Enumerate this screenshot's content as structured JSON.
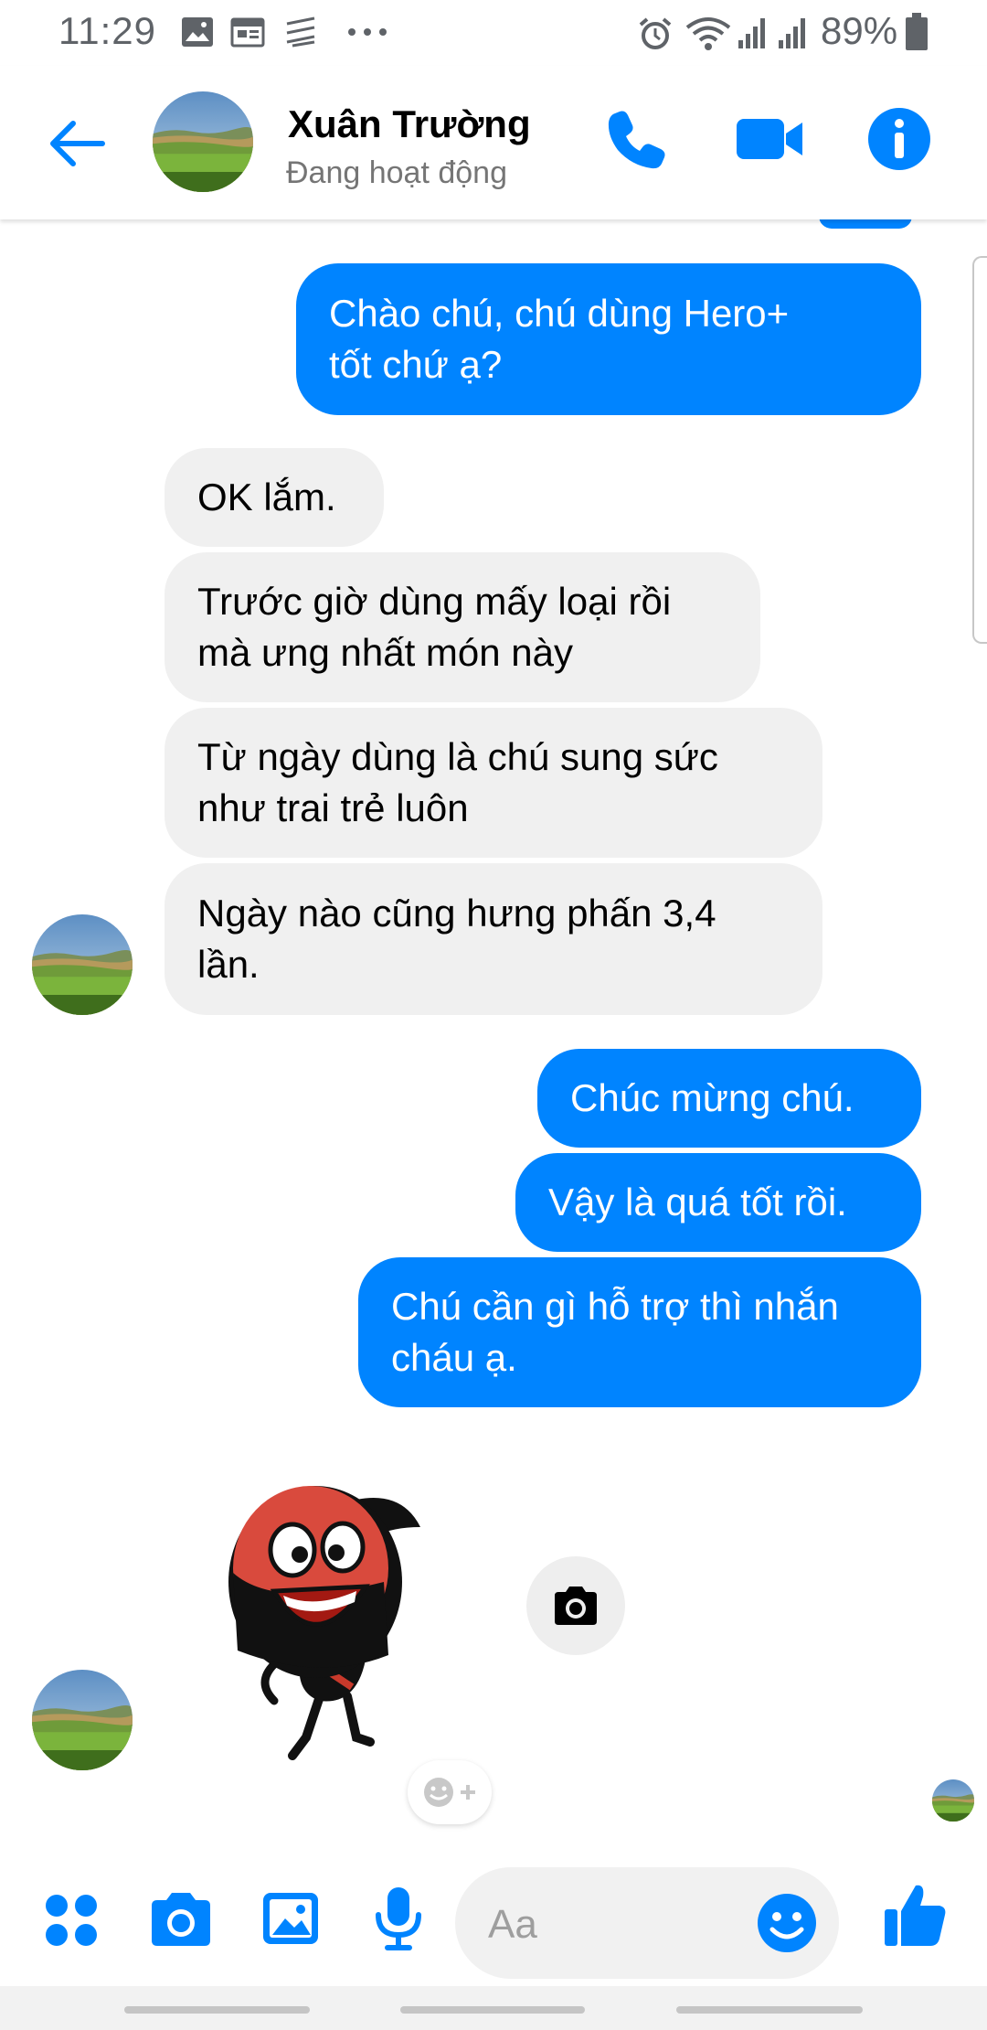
{
  "status_bar": {
    "time": "11:29",
    "battery": "89%",
    "icons": [
      "image-icon",
      "calendar-icon",
      "stack-icon",
      "more-dots-icon",
      "alarm-icon",
      "wifi-icon",
      "signal-icon",
      "signal-icon",
      "battery-icon"
    ]
  },
  "header": {
    "name": "Xuân Trường",
    "status": "Đang hoạt động",
    "actions": [
      "phone-icon",
      "video-icon",
      "info-icon"
    ]
  },
  "messages": [
    {
      "dir": "out",
      "text_lines": [
        "Chào chú, chú dùng Hero+",
        "tốt chứ ạ?"
      ]
    },
    {
      "dir": "in",
      "text": "OK lắm."
    },
    {
      "dir": "in",
      "text_lines": [
        "Trước giờ dùng mấy loại rồi",
        "mà ưng nhất món này"
      ]
    },
    {
      "dir": "in",
      "text_lines": [
        "Từ ngày dùng là chú sung sức",
        "như trai trẻ luôn"
      ]
    },
    {
      "dir": "in",
      "text_lines": [
        "Ngày nào cũng hưng phấn 3,4",
        "lần."
      ]
    },
    {
      "dir": "out",
      "text": "Chúc mừng chú."
    },
    {
      "dir": "out",
      "text": "Vậy là quá tốt rồi."
    },
    {
      "dir": "out",
      "text_lines": [
        "Chú cần gì hỗ trợ thì nhắn",
        "cháu ạ."
      ]
    }
  ],
  "composer": {
    "placeholder": "Aa",
    "icons": [
      "apps-icon",
      "camera-icon",
      "gallery-icon",
      "mic-icon",
      "emoji-icon",
      "like-icon"
    ]
  },
  "colors": {
    "accent": "#0084ff",
    "incoming_bubble": "#f0f0f0",
    "header_icon": "#0084ff"
  }
}
